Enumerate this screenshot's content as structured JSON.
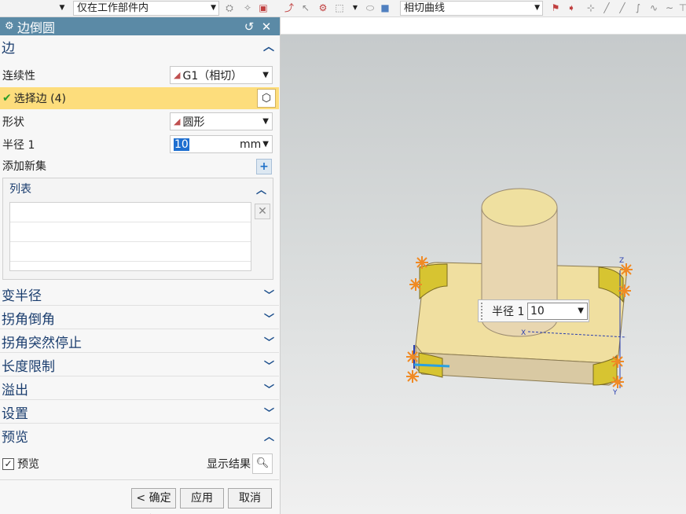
{
  "toolbar": {
    "filter_value": "仅在工作部件内",
    "curve_rule": "相切曲线"
  },
  "dialog": {
    "title": "边倒圆",
    "edge_section": {
      "title": "边",
      "continuity_label": "连续性",
      "continuity_value": "G1（相切）",
      "select_edge_label": "选择边 (4)",
      "shape_label": "形状",
      "shape_value": "圆形",
      "radius_label": "半径 1",
      "radius_value": "10",
      "radius_unit": "mm",
      "add_new_set_label": "添加新集",
      "list_label": "列表"
    },
    "collapsed_sections": [
      "变半径",
      "拐角倒角",
      "拐角突然停止",
      "长度限制",
      "溢出",
      "设置"
    ],
    "preview": {
      "title": "预览",
      "checkbox_label": "预览",
      "checked": true,
      "show_result_label": "显示结果"
    },
    "buttons": {
      "ok": "< 确定 >",
      "apply": "应用",
      "cancel": "取消"
    }
  },
  "graphics": {
    "radius_popup_label": "半径 1",
    "radius_popup_value": "10",
    "axis_labels": {
      "z": "Z",
      "x": "X",
      "y": "Y"
    }
  }
}
